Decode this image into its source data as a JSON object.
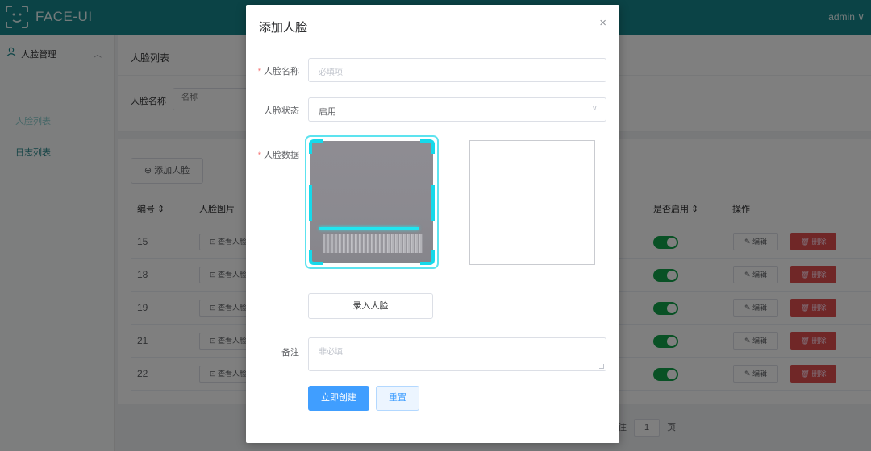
{
  "header": {
    "app_title": "FACE-UI",
    "user": "admin ∨",
    "bg_color": "#17878c"
  },
  "sidebar": {
    "group_label": "人脸管理",
    "group_icon": "user-icon",
    "items": [
      {
        "label": "人脸列表",
        "active": true
      },
      {
        "label": "日志列表",
        "active": false
      }
    ]
  },
  "main": {
    "page_title": "人脸列表",
    "filter": {
      "label": "人脸名称",
      "placeholder": "名称"
    },
    "add_button": "⊕ 添加人脸",
    "columns": {
      "id": "编号 ⇕",
      "image": "人脸图片",
      "enabled": "是否启用 ⇕",
      "actions": "操作"
    },
    "rows": [
      {
        "id": "15",
        "view": "⊡ 查看人脸",
        "edit": "✎ 编辑",
        "delete": "🗑 删除",
        "enabled": true
      },
      {
        "id": "18",
        "view": "⊡ 查看人脸",
        "edit": "✎ 编辑",
        "delete": "🗑 删除",
        "enabled": true
      },
      {
        "id": "19",
        "view": "⊡ 查看人脸",
        "edit": "✎ 编辑",
        "delete": "🗑 删除",
        "enabled": true
      },
      {
        "id": "21",
        "view": "⊡ 查看人脸",
        "edit": "✎ 编辑",
        "delete": "🗑 删除",
        "enabled": true
      },
      {
        "id": "22",
        "view": "⊡ 查看人脸",
        "edit": "✎ 编辑",
        "delete": "🗑 删除",
        "enabled": true
      }
    ],
    "pager": {
      "prefix": "往",
      "page": "1",
      "suffix": "页"
    }
  },
  "dialog": {
    "title": "添加人脸",
    "close": "×",
    "fields": {
      "name": {
        "label": "人脸名称",
        "placeholder": "必填项",
        "required": true
      },
      "status": {
        "label": "人脸状态",
        "value": "启用"
      },
      "data": {
        "label": "人脸数据",
        "required": true
      },
      "note": {
        "label": "备注",
        "placeholder": "非必填"
      }
    },
    "capture_button": "录入人脸",
    "submit_button": "立即创建",
    "reset_button": "重置"
  },
  "colors": {
    "accent": "#409eff",
    "scan": "#16d9ea",
    "switch_on": "#13a34a",
    "danger": "#e04f4f"
  }
}
